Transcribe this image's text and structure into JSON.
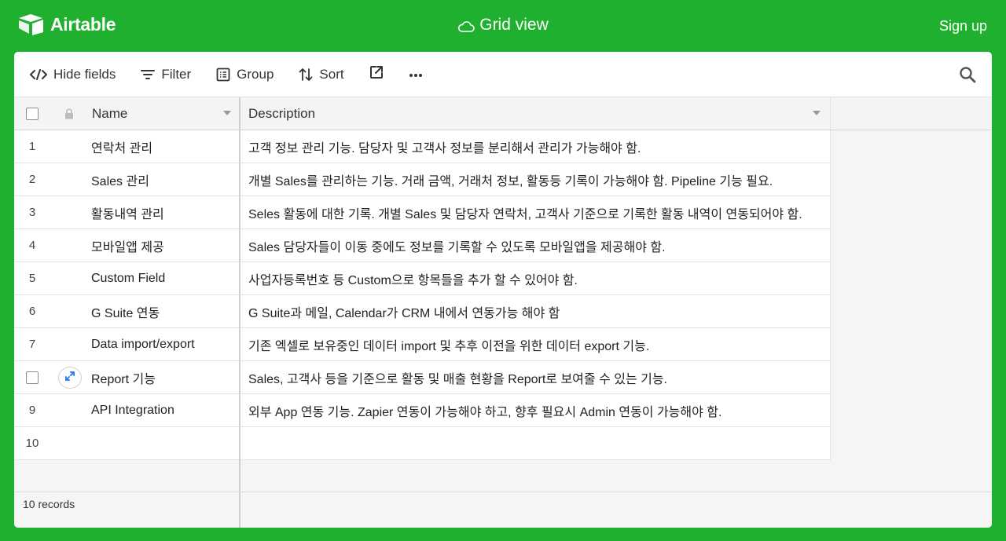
{
  "app": {
    "brand_name": "Airtable",
    "view_title": "Grid view",
    "signup_label": "Sign up",
    "brand_color": "#20b02f"
  },
  "toolbar": {
    "hide_fields_label": "Hide fields",
    "filter_label": "Filter",
    "group_label": "Group",
    "sort_label": "Sort",
    "share_icon": "share-icon",
    "more_icon": "more-icon",
    "search_icon": "search-icon"
  },
  "grid": {
    "columns": {
      "name": "Name",
      "description": "Description"
    },
    "rows": [
      {
        "num": "1",
        "name": "연락처 관리",
        "description": "고객 정보 관리 기능. 담당자 및 고객사 정보를 분리해서 관리가 가능해야 함."
      },
      {
        "num": "2",
        "name": "Sales 관리",
        "description": "개별 Sales를 관리하는 기능. 거래 금액, 거래처 정보, 활동등 기록이 가능해야 함. Pipeline 기능 필요."
      },
      {
        "num": "3",
        "name": "활동내역 관리",
        "description": "Seles 활동에 대한 기록. 개별 Sales 및 담당자 연락처, 고객사 기준으로 기록한 활동 내역이 연동되어야 함."
      },
      {
        "num": "4",
        "name": "모바일앱 제공",
        "description": "Sales 담당자들이 이동 중에도 정보를 기록할 수 있도록 모바일앱을 제공해야 함."
      },
      {
        "num": "5",
        "name": "Custom Field",
        "description": "사업자등록번호 등 Custom으로 항목들을 추가 할 수 있어야 함."
      },
      {
        "num": "6",
        "name": "G Suite 연동",
        "description": "G Suite과 메일, Calendar가 CRM 내에서 연동가능 해야 함"
      },
      {
        "num": "7",
        "name": "Data import/export",
        "description": "기존 엑셀로 보유중인 데이터 import 및 추후 이전을 위한 데이터 export 기능."
      },
      {
        "num": "",
        "name": "Report 기능",
        "description": "Sales, 고객사 등을 기준으로 활동 및 매출 현황을 Report로 보여줄 수 있는 기능."
      },
      {
        "num": "9",
        "name": "API Integration",
        "description": "외부 App 연동 기능. Zapier 연동이 가능해야 하고, 향후 필요시 Admin 연동이 가능해야 함."
      },
      {
        "num": "10",
        "name": "",
        "description": ""
      }
    ]
  },
  "footer": {
    "records_label": "10 records"
  }
}
